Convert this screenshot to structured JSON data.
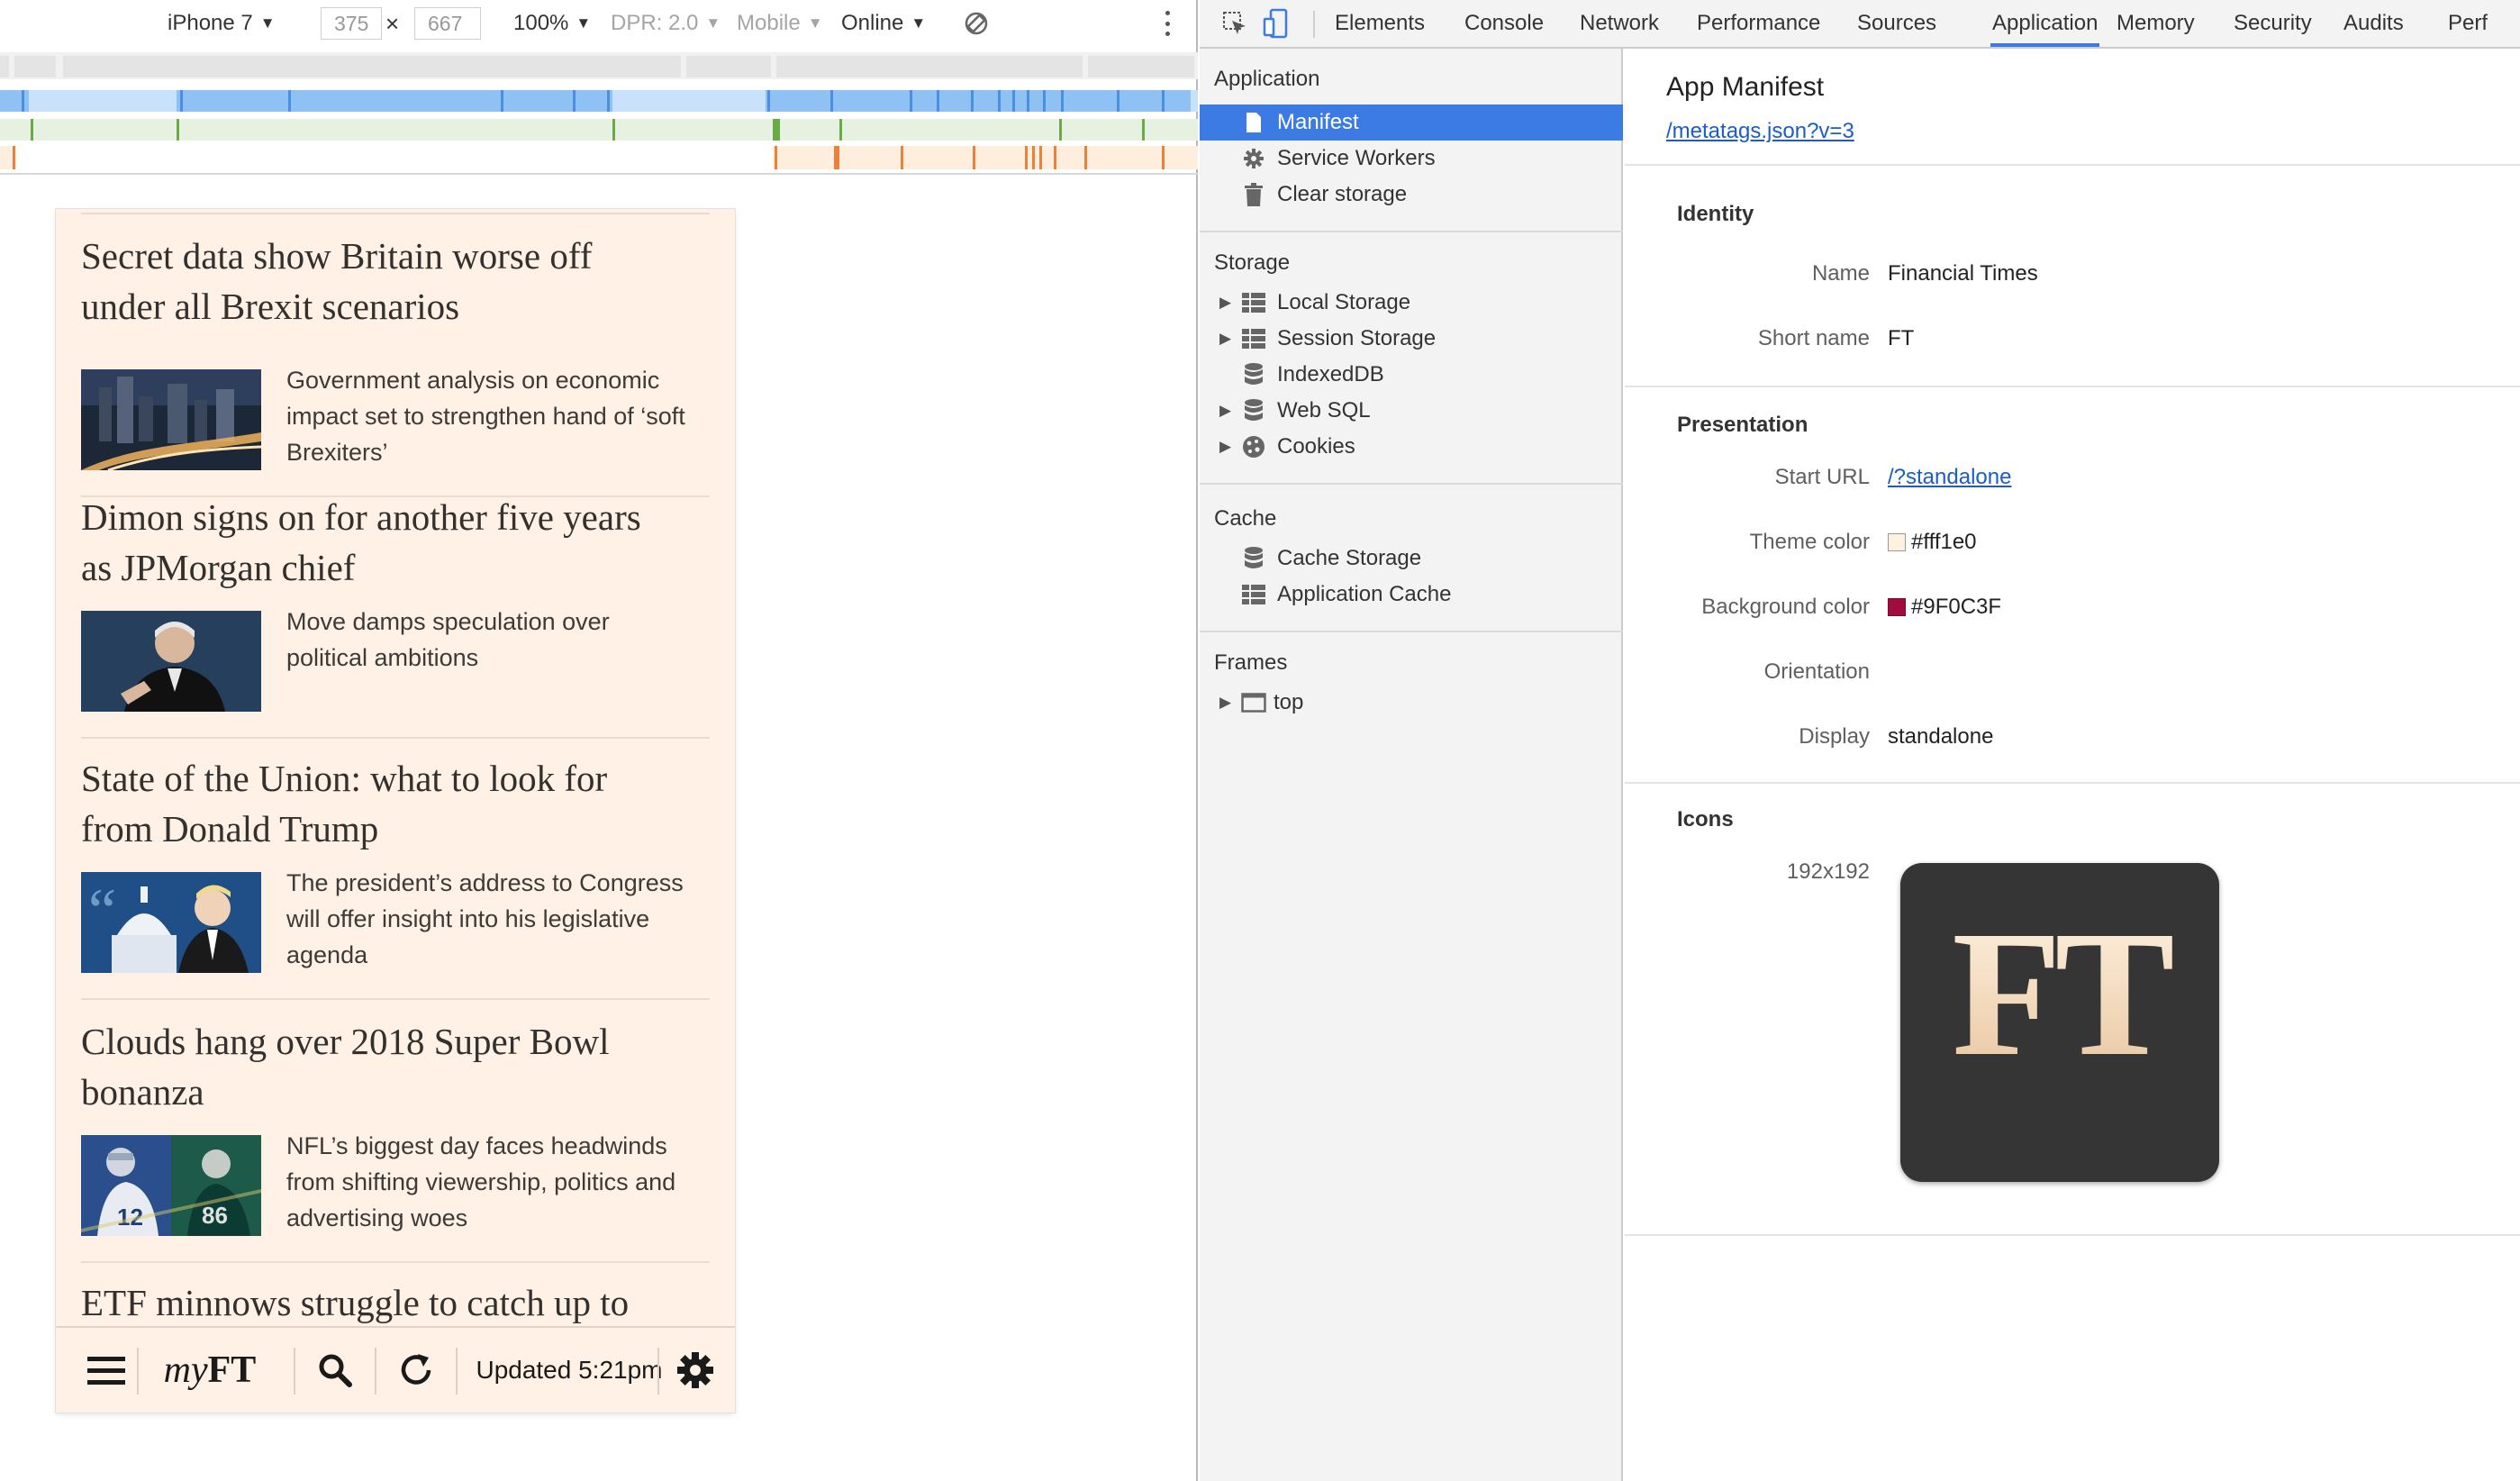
{
  "device_toolbar": {
    "device": "iPhone 7",
    "width": "375",
    "times": "×",
    "height": "667",
    "zoom": "100%",
    "dpr": "DPR: 2.0",
    "mode": "Mobile",
    "network": "Online"
  },
  "ft_page": {
    "articles": [
      {
        "headline_1": "Secret data show Britain worse off",
        "headline_2": "under all Brexit scenarios",
        "summary_1": "Government analysis on economic",
        "summary_2": "impact set to strengthen hand of ‘soft",
        "summary_3": "Brexiters’"
      },
      {
        "headline_1": "Dimon signs on for another five years",
        "headline_2": "as JPMorgan chief",
        "summary_1": "Move damps speculation over",
        "summary_2": "political ambitions",
        "summary_3": ""
      },
      {
        "headline_1": "State of the Union: what to look for",
        "headline_2": "from Donald Trump",
        "summary_1": "The president’s address to Congress",
        "summary_2": "will offer insight into his legislative",
        "summary_3": "agenda"
      },
      {
        "headline_1": "Clouds hang over 2018 Super Bowl",
        "headline_2": "bonanza",
        "summary_1": "NFL’s biggest day faces headwinds",
        "summary_2": "from shifting viewership, politics and",
        "summary_3": "advertising woes"
      },
      {
        "headline_1": "ETF minnows struggle to catch up to",
        "headline_2": "",
        "summary_1": "",
        "summary_2": "",
        "summary_3": ""
      }
    ],
    "bottom_bar": {
      "logo_my": "my",
      "logo_ft": "FT",
      "updated": "Updated 5:21pm"
    }
  },
  "devtools": {
    "tabs": [
      "Elements",
      "Console",
      "Network",
      "Performance",
      "Sources",
      "Application",
      "Memory",
      "Security",
      "Audits",
      "Perf"
    ],
    "active_tab": "Application",
    "sidebar": {
      "application": {
        "header": "Application",
        "items": [
          "Manifest",
          "Service Workers",
          "Clear storage"
        ]
      },
      "storage": {
        "header": "Storage",
        "items": [
          "Local Storage",
          "Session Storage",
          "IndexedDB",
          "Web SQL",
          "Cookies"
        ]
      },
      "cache": {
        "header": "Cache",
        "items": [
          "Cache Storage",
          "Application Cache"
        ]
      },
      "frames": {
        "header": "Frames",
        "items": [
          "top"
        ]
      }
    },
    "manifest": {
      "title": "App Manifest",
      "link": "/metatags.json?v=3",
      "identity": {
        "header": "Identity",
        "name_label": "Name",
        "name_value": "Financial Times",
        "short_name_label": "Short name",
        "short_name_value": "FT"
      },
      "presentation": {
        "header": "Presentation",
        "start_url_label": "Start URL",
        "start_url_value": "/?standalone",
        "theme_color_label": "Theme color",
        "theme_color_value": "#fff1e0",
        "background_color_label": "Background color",
        "background_color_value": "#9F0C3F",
        "orientation_label": "Orientation",
        "orientation_value": "",
        "display_label": "Display",
        "display_value": "standalone"
      },
      "icons": {
        "header": "Icons",
        "size_label": "192x192",
        "icon_text": "FT"
      }
    }
  },
  "colors": {
    "ft_paper": "#fff1e5",
    "devtools_accent": "#3b7be3",
    "link": "#1a5cc8",
    "theme_swatch": "#fff1e0",
    "background_swatch": "#9F0C3F"
  }
}
